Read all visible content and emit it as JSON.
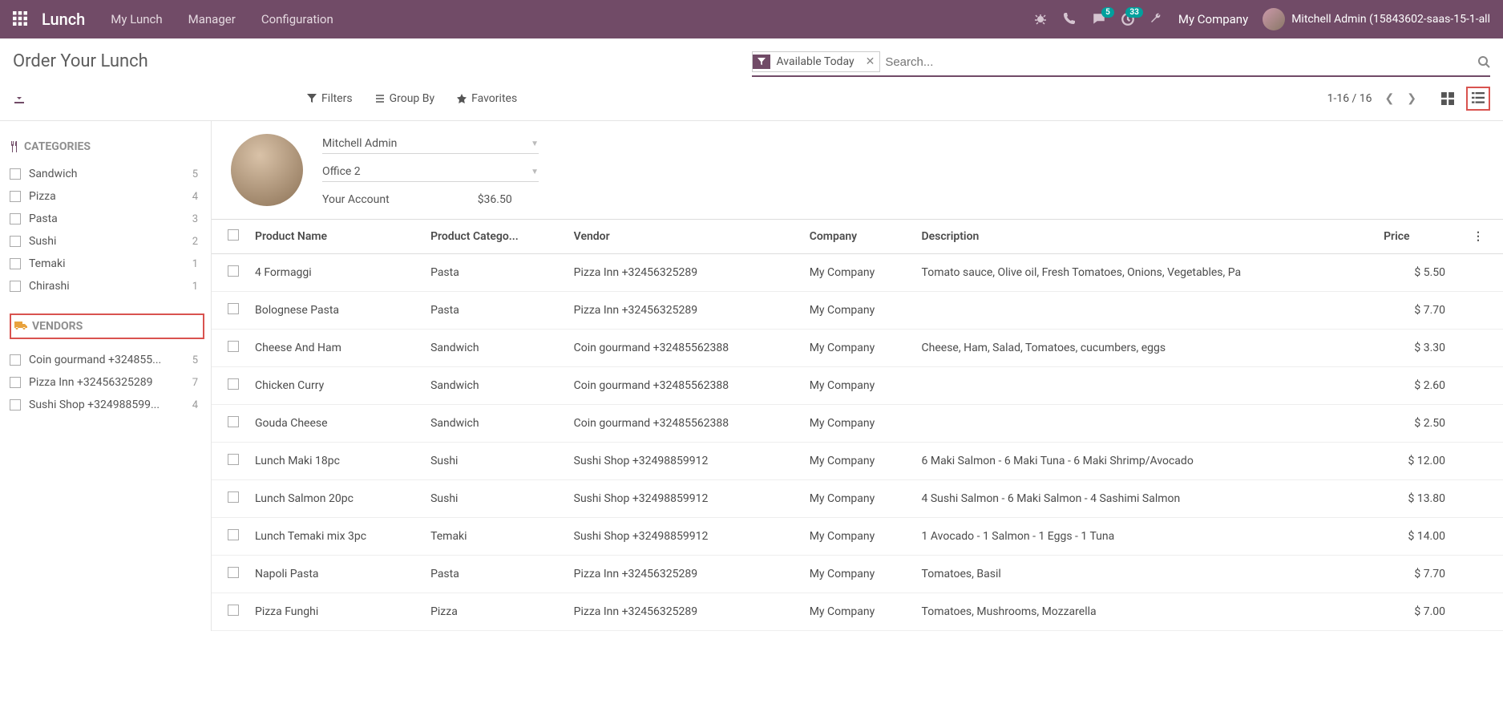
{
  "navbar": {
    "app": "Lunch",
    "menu": [
      "My Lunch",
      "Manager",
      "Configuration"
    ],
    "msg_count": "5",
    "activity_count": "33",
    "company": "My Company",
    "user": "Mitchell Admin (15843602-saas-15-1-all"
  },
  "control": {
    "title": "Order Your Lunch",
    "facet": "Available Today",
    "search_placeholder": "Search...",
    "filters": "Filters",
    "groupby": "Group By",
    "favorites": "Favorites",
    "pager": "1-16 / 16"
  },
  "sidebar": {
    "cat_header": "CATEGORIES",
    "vendor_header": "VENDORS",
    "categories": [
      {
        "label": "Sandwich",
        "count": "5"
      },
      {
        "label": "Pizza",
        "count": "4"
      },
      {
        "label": "Pasta",
        "count": "3"
      },
      {
        "label": "Sushi",
        "count": "2"
      },
      {
        "label": "Temaki",
        "count": "1"
      },
      {
        "label": "Chirashi",
        "count": "1"
      }
    ],
    "vendors": [
      {
        "label": "Coin gourmand +324855...",
        "count": "5"
      },
      {
        "label": "Pizza Inn +32456325289",
        "count": "7"
      },
      {
        "label": "Sushi Shop +324988599...",
        "count": "4"
      }
    ]
  },
  "user_panel": {
    "name": "Mitchell Admin",
    "location": "Office 2",
    "account_label": "Your Account",
    "balance": "$36.50"
  },
  "table": {
    "headers": {
      "name": "Product Name",
      "category": "Product Catego...",
      "vendor": "Vendor",
      "company": "Company",
      "description": "Description",
      "price": "Price"
    },
    "rows": [
      {
        "name": "4 Formaggi",
        "category": "Pasta",
        "vendor": "Pizza Inn +32456325289",
        "company": "My Company",
        "description": "Tomato sauce, Olive oil, Fresh Tomatoes, Onions, Vegetables, Pa",
        "price": "$ 5.50"
      },
      {
        "name": "Bolognese Pasta",
        "category": "Pasta",
        "vendor": "Pizza Inn +32456325289",
        "company": "My Company",
        "description": "",
        "price": "$ 7.70"
      },
      {
        "name": "Cheese And Ham",
        "category": "Sandwich",
        "vendor": "Coin gourmand +32485562388",
        "company": "My Company",
        "description": "Cheese, Ham, Salad, Tomatoes, cucumbers, eggs",
        "price": "$ 3.30"
      },
      {
        "name": "Chicken Curry",
        "category": "Sandwich",
        "vendor": "Coin gourmand +32485562388",
        "company": "My Company",
        "description": "",
        "price": "$ 2.60"
      },
      {
        "name": "Gouda Cheese",
        "category": "Sandwich",
        "vendor": "Coin gourmand +32485562388",
        "company": "My Company",
        "description": "",
        "price": "$ 2.50"
      },
      {
        "name": "Lunch Maki 18pc",
        "category": "Sushi",
        "vendor": "Sushi Shop +32498859912",
        "company": "My Company",
        "description": "6 Maki Salmon - 6 Maki Tuna - 6 Maki Shrimp/Avocado",
        "price": "$ 12.00"
      },
      {
        "name": "Lunch Salmon 20pc",
        "category": "Sushi",
        "vendor": "Sushi Shop +32498859912",
        "company": "My Company",
        "description": "4 Sushi Salmon - 6 Maki Salmon - 4 Sashimi Salmon",
        "price": "$ 13.80"
      },
      {
        "name": "Lunch Temaki mix 3pc",
        "category": "Temaki",
        "vendor": "Sushi Shop +32498859912",
        "company": "My Company",
        "description": "1 Avocado - 1 Salmon - 1 Eggs - 1 Tuna",
        "price": "$ 14.00"
      },
      {
        "name": "Napoli Pasta",
        "category": "Pasta",
        "vendor": "Pizza Inn +32456325289",
        "company": "My Company",
        "description": "Tomatoes, Basil",
        "price": "$ 7.70"
      },
      {
        "name": "Pizza Funghi",
        "category": "Pizza",
        "vendor": "Pizza Inn +32456325289",
        "company": "My Company",
        "description": "Tomatoes, Mushrooms, Mozzarella",
        "price": "$ 7.00"
      }
    ]
  }
}
